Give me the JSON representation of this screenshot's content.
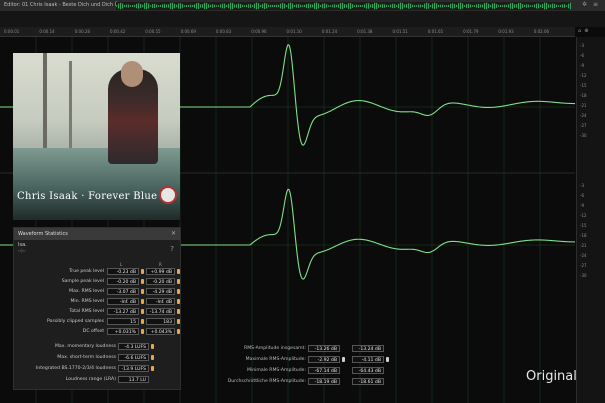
{
  "window": {
    "title": "Editor: 01 Chris Isaak - Beste Dich und Dich Übergabe *"
  },
  "ruler_ticks": [
    "0:00.01",
    "0:00.14",
    "0:00.28",
    "0:00.42",
    "0:00.55",
    "0:00.69",
    "0:00.83",
    "0:00.96",
    "0:01.10",
    "0:01.24",
    "0:01.38",
    "0:01.51",
    "0:01.65",
    "0:01.79",
    "0:01.93",
    "0:02.06"
  ],
  "db_scale": {
    "top": [
      "-3",
      "-6",
      "-9",
      "-12",
      "-15",
      "-18",
      "-21",
      "-24",
      "-27",
      "-30"
    ],
    "bottom": [
      "-3",
      "-6",
      "-9",
      "-12",
      "-15",
      "-18",
      "-21",
      "-24",
      "-27",
      "-30"
    ]
  },
  "cover": {
    "title": "Chris Isaak · Forever Blue"
  },
  "stats": {
    "panel_title": "Waveform Statistics",
    "tab": "Isa.",
    "tab_sub": "‹‹|››",
    "col_left": "L",
    "col_right": "R",
    "rows": [
      {
        "label": "True peak level",
        "l": "-0.23 dB",
        "r": "+0.99 dB"
      },
      {
        "label": "Sample peak level",
        "l": "-0.20 dB",
        "r": "-0.20 dB"
      },
      {
        "label": "Max. RMS level",
        "l": "-3.07 dB",
        "r": "-4.29 dB"
      },
      {
        "label": "Min. RMS level",
        "l": "-Inf. dB",
        "r": "-Inf. dB"
      },
      {
        "label": "Total RMS level",
        "l": "-13.27 dB",
        "r": "-13.74 dB"
      },
      {
        "label": "Possibly clipped samples",
        "l": "15",
        "r": "183"
      },
      {
        "label": "DC offset",
        "l": "+0.031%",
        "r": "+0.043%"
      }
    ],
    "loudness": [
      {
        "label": "Max. momentary loudness",
        "v": "-4.3 LUFS"
      },
      {
        "label": "Max. short-term loudness",
        "v": "-6.6 LUFS"
      },
      {
        "label": "Integrated BS.1770-2/3/4 loudness",
        "v": "-13.9 LUFS"
      },
      {
        "label": "Loudness range (LRA)",
        "v": "13.7 LU"
      }
    ]
  },
  "rms": [
    {
      "label": "RMS-Amplitude insgesamt:",
      "l": "-13.26 dB",
      "r": "-13.24 dB"
    },
    {
      "label": "Maximale RMS-Amplitude:",
      "l": "-2.92 dB",
      "r": "-4.11 dB"
    },
    {
      "label": "Minimale RMS-Amplitude:",
      "l": "-67.14 dB",
      "r": "-64.43 dB"
    },
    {
      "label": "Durchschnittliche RMS-Amplitude:",
      "l": "-18.19 dB",
      "r": "-18.61 dB"
    }
  ],
  "watermark": "Original",
  "colors": {
    "waveform": "#7ee08a",
    "bulb": "#f0a640",
    "background": "#0b0b0b"
  }
}
